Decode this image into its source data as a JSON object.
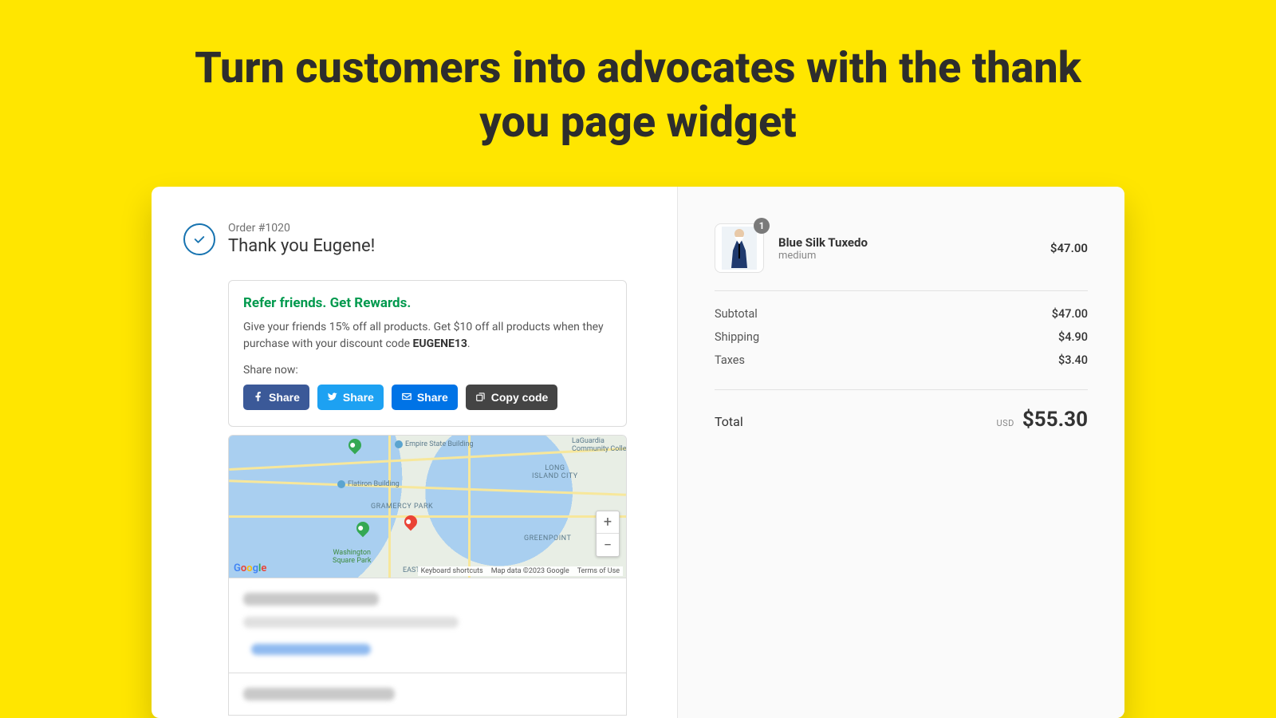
{
  "headline": "Turn customers into advocates with the thank you page widget",
  "order": {
    "number": "Order #1020",
    "thank_you": "Thank you Eugene!"
  },
  "refer": {
    "title": "Refer friends. Get Rewards.",
    "desc_a": "Give your friends 15% off all products. Get $10 off all products when they purchase with your discount code ",
    "code": "EUGENE13",
    "desc_b": ".",
    "share_now": "Share now:",
    "fb_label": "Share",
    "tw_label": "Share",
    "email_label": "Share",
    "copy_label": "Copy code"
  },
  "map": {
    "poi_esb": "Empire State Building",
    "poi_flatiron": "Flatiron Building",
    "lbl_gramercy": "GRAMERCY PARK",
    "lbl_eastvillage": "EAST VILLAGE",
    "lbl_wsp": "Washington\nSquare Park",
    "lbl_lic": "LONG\nISLAND CITY",
    "lbl_greenpoint": "GREENPOINT",
    "lbl_laguardia": "LaGuardia\nCommunity College",
    "lbl_east": "EAST",
    "kb_shortcuts": "Keyboard shortcuts",
    "attribution": "Map data ©2023 Google",
    "terms": "Terms of Use",
    "zoom_in": "+",
    "zoom_out": "−"
  },
  "summary": {
    "product_name": "Blue Silk Tuxedo",
    "variant": "medium",
    "qty": "1",
    "product_price": "$47.00",
    "subtotal_label": "Subtotal",
    "subtotal": "$47.00",
    "shipping_label": "Shipping",
    "shipping": "$4.90",
    "taxes_label": "Taxes",
    "taxes": "$3.40",
    "total_label": "Total",
    "currency": "USD",
    "total": "$55.30"
  }
}
